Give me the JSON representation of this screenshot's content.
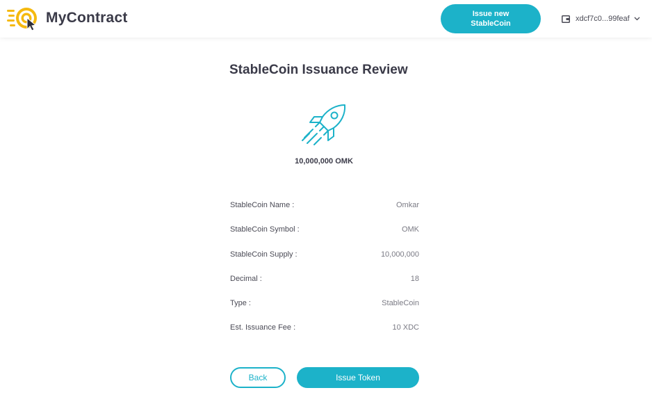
{
  "header": {
    "brand": "MyContract",
    "issue_button_line1": "Issue new",
    "issue_button_line2": "StableCoin",
    "wallet_address": "xdcf7c0...99feaf",
    "wallet_icon": "wallet-icon",
    "dropdown_icon": "chevron-down-icon",
    "logo_icon": "target-pointer-logo"
  },
  "main": {
    "title": "StableCoin Issuance Review",
    "hero_icon": "rocket-icon",
    "amount": "10,000,000 OMK",
    "details": [
      {
        "label": "StableCoin Name :",
        "value": "Omkar"
      },
      {
        "label": "StableCoin Symbol :",
        "value": "OMK"
      },
      {
        "label": "StableCoin Supply :",
        "value": "10,000,000"
      },
      {
        "label": "Decimal :",
        "value": "18"
      },
      {
        "label": "Type :",
        "value": "StableCoin"
      },
      {
        "label": "Est. Issuance Fee :",
        "value": "10 XDC"
      }
    ],
    "back_label": "Back",
    "issue_label": "Issue Token"
  },
  "colors": {
    "accent": "#1cb2c9",
    "logo_yellow": "#f5b90f",
    "text_dark": "#3a3a48"
  }
}
